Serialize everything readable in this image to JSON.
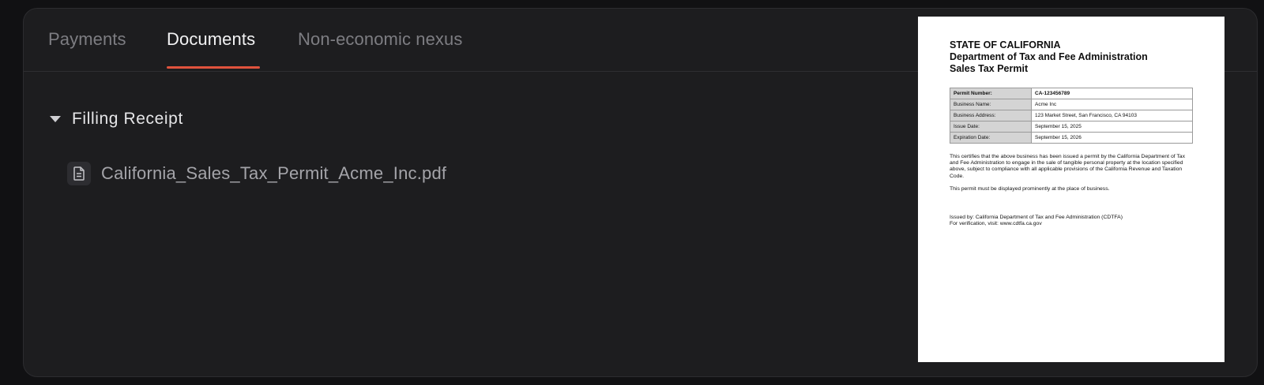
{
  "tabs": [
    {
      "label": "Payments",
      "active": false
    },
    {
      "label": "Documents",
      "active": true
    },
    {
      "label": "Non-economic nexus",
      "active": false
    }
  ],
  "accent_color": "#e0533d",
  "group": {
    "title": "Filling Receipt",
    "icon": "caret-down-icon",
    "files": [
      {
        "name": "California_Sales_Tax_Permit_Acme_Inc.pdf",
        "icon": "document-icon"
      }
    ]
  },
  "preview": {
    "heading": [
      "STATE OF CALIFORNIA",
      "Department of Tax and Fee Administration",
      "Sales Tax Permit"
    ],
    "table": [
      {
        "label": "Permit Number:",
        "value": "CA-123456789"
      },
      {
        "label": "Business Name:",
        "value": "Acme Inc"
      },
      {
        "label": "Business Address:",
        "value": "123 Market Street, San Francisco, CA 94103"
      },
      {
        "label": "Issue Date:",
        "value": "September 15, 2025"
      },
      {
        "label": "Expiration Date:",
        "value": "September 15, 2026"
      }
    ],
    "paragraph1": "This certifies that the above business has been issued a permit by the California Department of Tax and Fee Administration to engage in the sale of tangible personal property at the location specified above, subject to compliance with all applicable provisions of the California Revenue and Taxation Code.",
    "paragraph2": "This permit must be displayed prominently at the place of business.",
    "issued_by": "Issued by: California Department of Tax and Fee Administration (CDTFA)",
    "verification": "For verification, visit: www.cdtfa.ca.gov"
  }
}
